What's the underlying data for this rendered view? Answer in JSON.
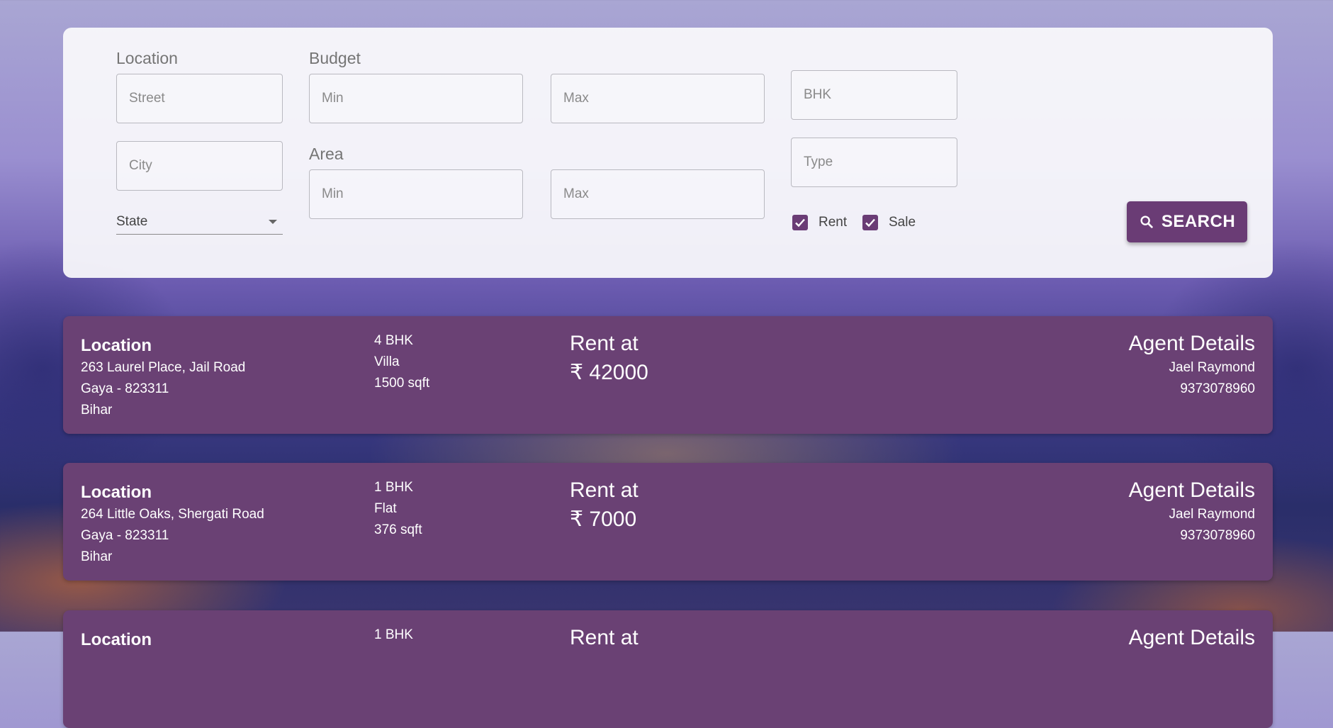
{
  "filters": {
    "location_label": "Location",
    "street_placeholder": "Street",
    "city_placeholder": "City",
    "state_label": "State",
    "budget_label": "Budget",
    "budget_min_placeholder": "Min",
    "budget_max_placeholder": "Max",
    "area_label": "Area",
    "area_min_placeholder": "Min",
    "area_max_placeholder": "Max",
    "bhk_placeholder": "BHK",
    "type_placeholder": "Type",
    "rent_label": "Rent",
    "rent_checked": true,
    "sale_label": "Sale",
    "sale_checked": true,
    "search_label": "SEARCH"
  },
  "listings": [
    {
      "location_title": "Location",
      "address": "263 Laurel Place, Jail Road",
      "city_pin": "Gaya - 823311",
      "state": "Bihar",
      "bhk": "4 BHK",
      "type": "Villa",
      "area": "1500 sqft",
      "price_label": "Rent at",
      "price": "₹ 42000",
      "agent_title": "Agent Details",
      "agent_name": "Jael Raymond",
      "agent_phone": "9373078960"
    },
    {
      "location_title": "Location",
      "address": "264 Little Oaks, Shergati Road",
      "city_pin": "Gaya - 823311",
      "state": "Bihar",
      "bhk": "1 BHK",
      "type": "Flat",
      "area": "376 sqft",
      "price_label": "Rent at",
      "price": "₹ 7000",
      "agent_title": "Agent Details",
      "agent_name": "Jael Raymond",
      "agent_phone": "9373078960"
    },
    {
      "location_title": "Location",
      "bhk": "1 BHK",
      "price_label": "Rent at",
      "agent_title": "Agent Details"
    }
  ],
  "colors": {
    "accent": "#6a3c75",
    "card_bg": "#6a4174"
  }
}
